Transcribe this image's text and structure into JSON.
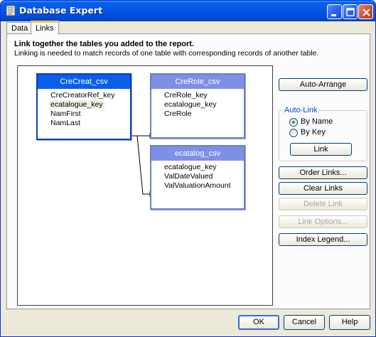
{
  "window": {
    "title": "Database Expert",
    "controls": [
      "minimize-icon",
      "maximize-icon",
      "close-icon"
    ]
  },
  "tabs": [
    {
      "label": "Data",
      "active": false
    },
    {
      "label": "Links",
      "active": true
    }
  ],
  "links": {
    "heading": "Link together the tables you added to the report.",
    "subheading": "Linking is needed to match records of one table with corresponding records of another table.",
    "tables": [
      {
        "name": "CreCreat_csv",
        "selected": true,
        "fields": [
          "CreCreatorRef_key",
          "ecatalogue_key",
          "NamFirst",
          "NamLast"
        ]
      },
      {
        "name": "CreRole_csv",
        "selected": false,
        "fields": [
          "CreRole_key",
          "ecatalogue_key",
          "CreRole"
        ]
      },
      {
        "name": "ecatalog_csv",
        "selected": false,
        "fields": [
          "ecatalogue_key",
          "ValDateValued",
          "ValValuationAmount"
        ]
      }
    ],
    "buttons": {
      "auto_arrange": "Auto-Arrange",
      "link": "Link",
      "order_links": "Order Links...",
      "clear_links": "Clear Links",
      "delete_link": "Delete Link",
      "link_options": "Link Options...",
      "index_legend": "Index Legend..."
    },
    "auto_link": {
      "label": "Auto-Link",
      "by_name": "By Name",
      "by_key": "By Key",
      "selected": "By Name"
    }
  },
  "footer": {
    "ok": "OK",
    "cancel": "Cancel",
    "help": "Help"
  },
  "colors": {
    "title_bar": "#0054e3",
    "selected_table_header": "#0a5ee8",
    "table_header": "#7e90e6",
    "tab_highlight": "#ffc83c"
  }
}
